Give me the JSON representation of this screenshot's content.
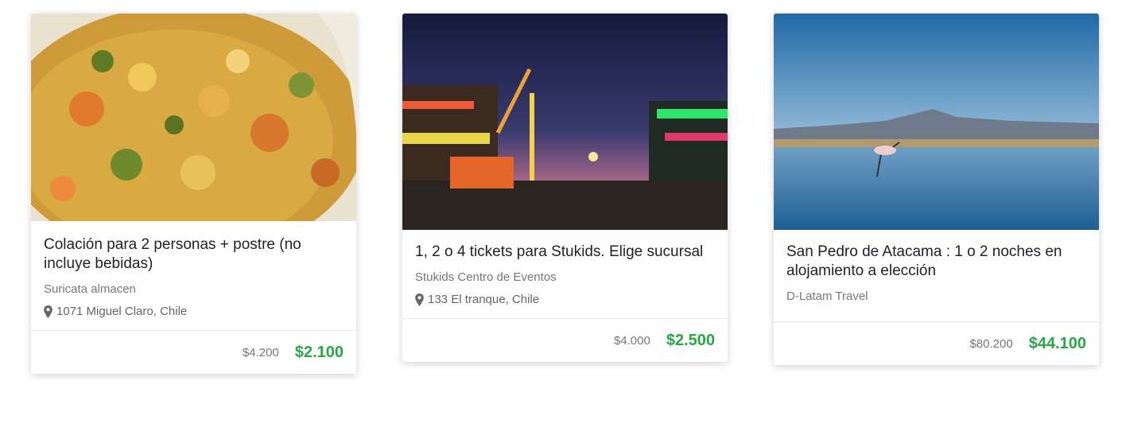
{
  "colors": {
    "price_accent": "#28a745"
  },
  "cards": [
    {
      "image_subject": "bowl of vegetable rice stew",
      "title": "Colación para 2 personas + postre (no incluye bebidas)",
      "vendor": "Suricata almacen",
      "location": "1071 Miguel Claro, Chile",
      "old_price": "$4.200",
      "new_price": "$2.100"
    },
    {
      "image_subject": "amusement park at night with rides",
      "title": "1, 2 o 4 tickets para Stukids. Elige sucursal",
      "vendor": "Stukids Centro de Eventos",
      "location": "133 El tranque, Chile",
      "old_price": "$4.000",
      "new_price": "$2.500"
    },
    {
      "image_subject": "flamingo in lagoon with mountains",
      "title": "San Pedro de Atacama : 1 o 2 noches en alojamiento a elección",
      "vendor": "D-Latam Travel",
      "old_price": "$80.200",
      "new_price": "$44.100"
    }
  ]
}
